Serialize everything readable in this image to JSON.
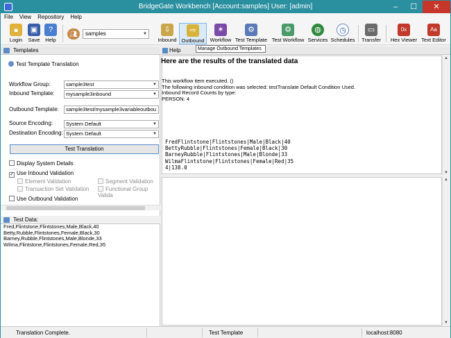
{
  "window": {
    "title": "BridgeGate Workbench [Account:samples] User: [admin]",
    "minimize": "–",
    "maximize": "☐",
    "close": "✕"
  },
  "menu": [
    "File",
    "View",
    "Repository",
    "Help"
  ],
  "toolbar": {
    "login": "Login",
    "save": "Save",
    "help": "Help",
    "account_value": "samples",
    "inbound": "Inbound",
    "outbound": "Outbound",
    "workflow": "Workflow",
    "test_template": "Test Template",
    "test_workflow": "Test Workflow",
    "services": "Services",
    "schedules": "Schedules",
    "transfer": "Transfer",
    "hex_viewer": "Hex Viewer",
    "text_editor": "Text Editor",
    "tooltip": "Manage Outbound Templates"
  },
  "left": {
    "header": "Templates",
    "section_title": "Test Template Translation",
    "workflow_group_label": "Workflow Group:",
    "workflow_group_value": "sample3test",
    "inbound_template_label": "Inbound Template:",
    "inbound_template_value": "mysample3inbound",
    "outbound_template_label": "Outbound Template:",
    "outbound_template_value": "sample3test/mysample3variableoutbou",
    "source_encoding_label": "Source Encoding:",
    "source_encoding_value": "System Default",
    "dest_encoding_label": "Destination Encoding:",
    "dest_encoding_value": "System Default",
    "test_button": "Test Translation",
    "display_system_details": "Display System Details",
    "use_inbound_validation": "Use Inbound Validation",
    "element_validation": "Element Validation",
    "segment_validation": "Segment Validation",
    "transaction_set_validation": "Transaction Set Validation",
    "functional_group_validation": "Functional Group Valida",
    "use_outbound_validation": "Use Outbound Validation",
    "test_data_label": "Test Data:",
    "test_data": [
      "Fred,Flintstone,Flintstones,Male,Black,40",
      "Betty,Rubble,Flintstones,Female,Black,30",
      "Barney,Rubble,Flintstones,Male,Blonde,33",
      "Wilma,Flintstone,Flintstones,Female,Red,35"
    ]
  },
  "right": {
    "header": "Help",
    "result_title": "Here are the results of the translated data",
    "messages": [
      "This workflow item executed. ()",
      "The following inbound condition was selected: testTranslate  Default Condition Used.",
      "Inbound Record Counts by type:",
      "PERSON: 4"
    ],
    "output": [
      "FredFlintstone|Flintstones|Male|Black|40",
      "BettyRubble|Flintstones|Female|Black|30",
      "BarneyRubble|Flintstones|Male|Blonde|33",
      "WilmaFlintstone|Flintstones|Female|Red|35",
      "4|138.0"
    ]
  },
  "status": {
    "message": "Translation Complete.",
    "context": "Test Template",
    "server": "localhost:8080"
  },
  "colors": {
    "titlebar": "#2a8f9f",
    "close": "#c7362a",
    "accent": "#5a8bc7"
  }
}
